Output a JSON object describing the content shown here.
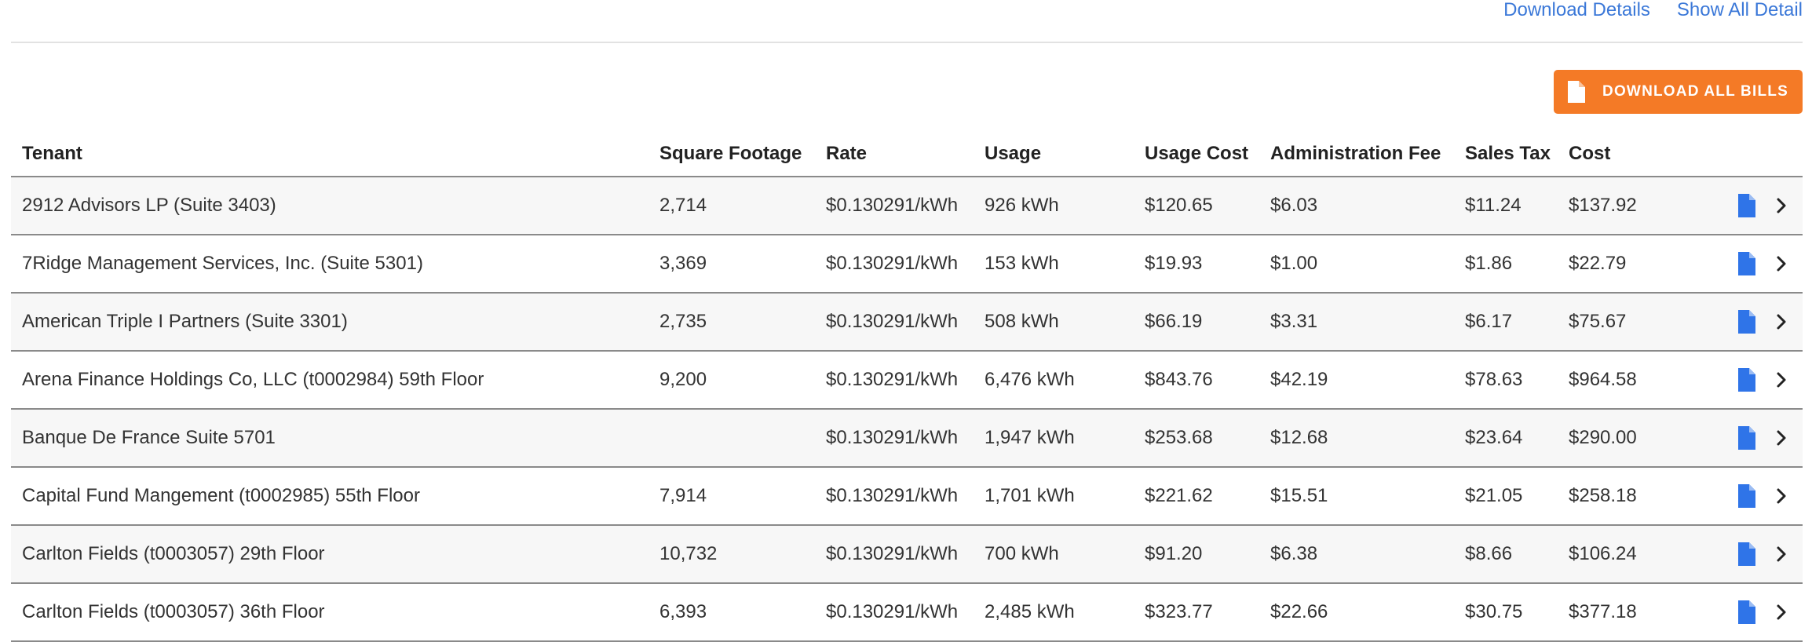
{
  "header": {
    "download_details": "Download Details",
    "show_all_detail": "Show All Detail"
  },
  "toolbar": {
    "download_all_bills": "DOWNLOAD ALL BILLS"
  },
  "colors": {
    "link": "#3b78d8",
    "accent_orange": "#f47a26",
    "document_icon_blue": "#2f74e8"
  },
  "icons": {
    "document": "document-icon",
    "chevron": "chevron-right-icon"
  },
  "table": {
    "columns": [
      "Tenant",
      "Square Footage",
      "Rate",
      "Usage",
      "Usage Cost",
      "Administration Fee",
      "Sales Tax",
      "Cost"
    ],
    "rows": [
      {
        "tenant": "2912 Advisors LP (Suite 3403)",
        "sqft": "2,714",
        "rate": "$0.130291/kWh",
        "usage": "926 kWh",
        "usage_cost": "$120.65",
        "admin_fee": "$6.03",
        "sales_tax": "$11.24",
        "cost": "$137.92"
      },
      {
        "tenant": "7Ridge Management Services, Inc. (Suite 5301)",
        "sqft": "3,369",
        "rate": "$0.130291/kWh",
        "usage": "153 kWh",
        "usage_cost": "$19.93",
        "admin_fee": "$1.00",
        "sales_tax": "$1.86",
        "cost": "$22.79"
      },
      {
        "tenant": "American Triple I Partners (Suite 3301)",
        "sqft": "2,735",
        "rate": "$0.130291/kWh",
        "usage": "508 kWh",
        "usage_cost": "$66.19",
        "admin_fee": "$3.31",
        "sales_tax": "$6.17",
        "cost": "$75.67"
      },
      {
        "tenant": "Arena Finance Holdings Co, LLC (t0002984) 59th Floor",
        "sqft": "9,200",
        "rate": "$0.130291/kWh",
        "usage": "6,476 kWh",
        "usage_cost": "$843.76",
        "admin_fee": "$42.19",
        "sales_tax": "$78.63",
        "cost": "$964.58"
      },
      {
        "tenant": "Banque De France Suite 5701",
        "sqft": "",
        "rate": "$0.130291/kWh",
        "usage": "1,947 kWh",
        "usage_cost": "$253.68",
        "admin_fee": "$12.68",
        "sales_tax": "$23.64",
        "cost": "$290.00"
      },
      {
        "tenant": "Capital Fund Mangement (t0002985) 55th Floor",
        "sqft": "7,914",
        "rate": "$0.130291/kWh",
        "usage": "1,701 kWh",
        "usage_cost": "$221.62",
        "admin_fee": "$15.51",
        "sales_tax": "$21.05",
        "cost": "$258.18"
      },
      {
        "tenant": "Carlton Fields (t0003057) 29th Floor",
        "sqft": "10,732",
        "rate": "$0.130291/kWh",
        "usage": "700 kWh",
        "usage_cost": "$91.20",
        "admin_fee": "$6.38",
        "sales_tax": "$8.66",
        "cost": "$106.24"
      },
      {
        "tenant": "Carlton Fields (t0003057) 36th Floor",
        "sqft": "6,393",
        "rate": "$0.130291/kWh",
        "usage": "2,485 kWh",
        "usage_cost": "$323.77",
        "admin_fee": "$22.66",
        "sales_tax": "$30.75",
        "cost": "$377.18"
      }
    ]
  }
}
